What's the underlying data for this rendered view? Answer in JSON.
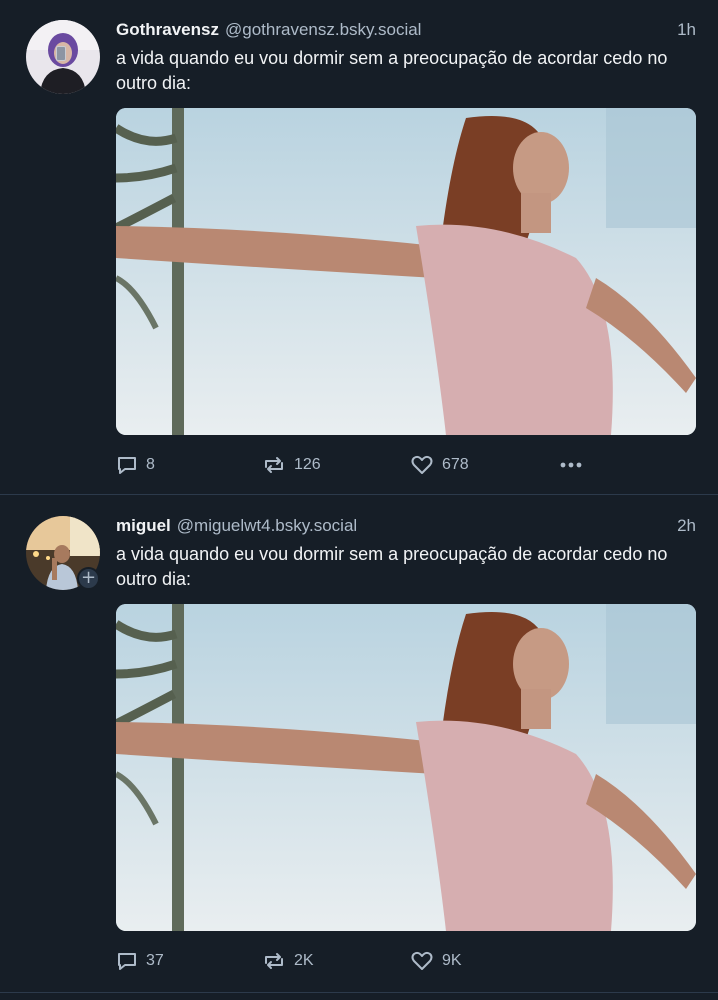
{
  "colors": {
    "background": "#161e27",
    "divider": "#2c3a4b",
    "text_primary": "#f1f3f5",
    "text_secondary": "#aebbc9"
  },
  "posts": [
    {
      "display_name": "Gothravensz",
      "handle": "@gothravensz.bsky.social",
      "time": "1h",
      "text": "a vida quando eu vou dormir sem a preocupação de acordar cedo no outro dia:",
      "has_follow_badge": false,
      "media": "gif-woman-arms-outstretched",
      "actions": {
        "reply_icon": "reply-icon",
        "reply_count": "8",
        "repost_icon": "repost-icon",
        "repost_count": "126",
        "like_icon": "heart-icon",
        "like_count": "678",
        "more_icon": "more-dots-icon"
      }
    },
    {
      "display_name": "miguel",
      "handle": "@miguelwt4.bsky.social",
      "time": "2h",
      "text": "a vida quando eu vou dormir sem a preocupação de acordar cedo no outro dia:",
      "has_follow_badge": true,
      "follow_badge": "+",
      "media": "gif-woman-arms-outstretched",
      "actions": {
        "reply_icon": "reply-icon",
        "reply_count": "37",
        "repost_icon": "repost-icon",
        "repost_count": "2K",
        "like_icon": "heart-icon",
        "like_count": "9K"
      }
    }
  ]
}
